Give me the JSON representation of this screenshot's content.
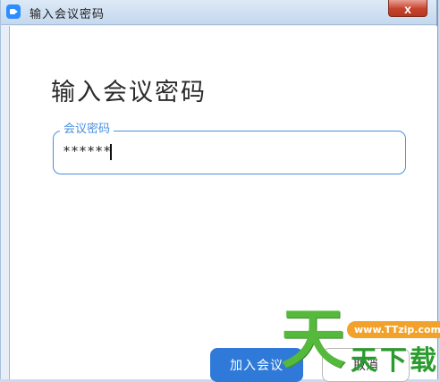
{
  "window": {
    "title": "输入会议密码",
    "close_label": "x"
  },
  "dialog": {
    "heading": "输入会议密码",
    "password_field": {
      "label": "会议密码",
      "value": "******"
    },
    "join_button": "加入会议",
    "cancel_button": "取消"
  },
  "watermark": {
    "glyph": "天",
    "url": "www.TTzip.com",
    "text": "天下载"
  },
  "colors": {
    "accent": "#2f7ad9",
    "field_border": "#4a8fe0",
    "watermark_green": "#55b93b",
    "watermark_orange": "#f2a12a"
  },
  "icons": [
    "zoom-app-icon",
    "close-icon"
  ]
}
